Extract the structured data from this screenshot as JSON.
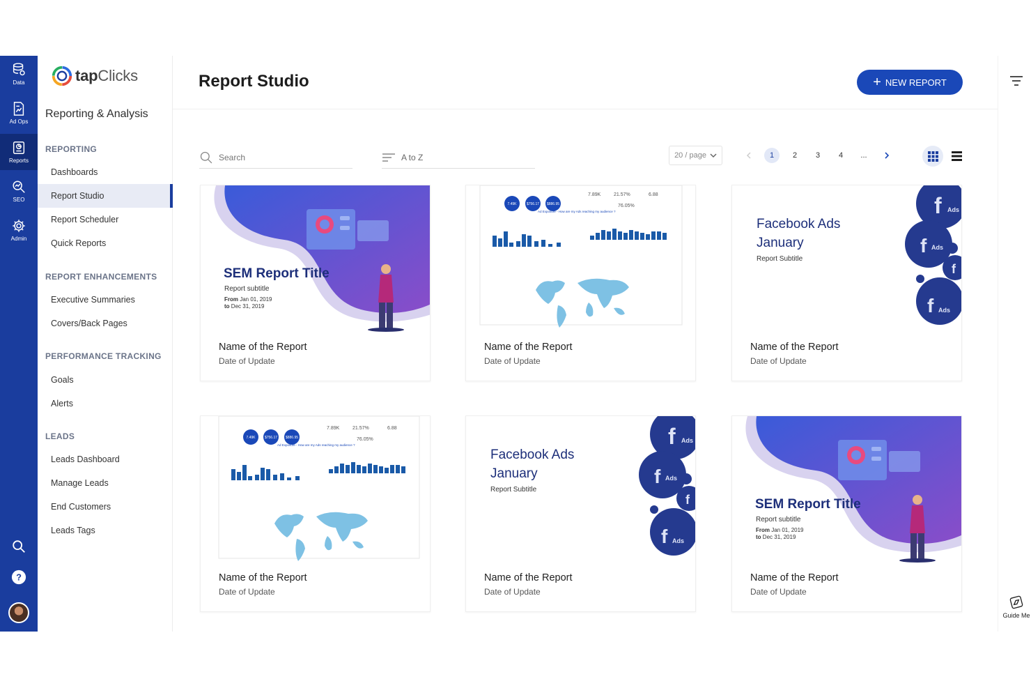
{
  "rail": {
    "items": [
      {
        "label": "Data",
        "icon": "database-icon"
      },
      {
        "label": "Ad Ops",
        "icon": "document-chart-icon"
      },
      {
        "label": "Reports",
        "icon": "report-icon"
      },
      {
        "label": "SEO",
        "icon": "seo-icon"
      },
      {
        "label": "Admin",
        "icon": "gear-icon"
      }
    ],
    "active": "Reports"
  },
  "brand": {
    "name_bold": "tap",
    "name_light": "Clicks"
  },
  "sidebar": {
    "section_title": "Reporting & Analysis",
    "groups": [
      {
        "heading": "REPORTING",
        "items": [
          "Dashboards",
          "Report Studio",
          "Report Scheduler",
          "Quick Reports"
        ]
      },
      {
        "heading": "REPORT ENHANCEMENTS",
        "items": [
          "Executive Summaries",
          "Covers/Back Pages"
        ]
      },
      {
        "heading": "PERFORMANCE TRACKING",
        "items": [
          "Goals",
          "Alerts"
        ]
      },
      {
        "heading": "LEADS",
        "items": [
          "Leads Dashboard",
          "Manage Leads",
          "End Customers",
          "Leads Tags"
        ]
      }
    ],
    "active_item": "Report Studio"
  },
  "header": {
    "title": "Report Studio",
    "new_report_label": "NEW REPORT"
  },
  "toolbar": {
    "search_placeholder": "Search",
    "sort_label": "A to Z",
    "per_page": "20 / page",
    "pages": [
      "1",
      "2",
      "3",
      "4",
      "..."
    ],
    "current_page": "1",
    "view_mode": "grid"
  },
  "thumbs": {
    "sem": {
      "title": "SEM Report Title",
      "subtitle": "Report subtitle",
      "from_label": "From",
      "from_date": "Jan 01, 2019",
      "to_label": "to",
      "to_date": "Dec 31, 2019"
    },
    "fb": {
      "title_line1": "Facebook Ads",
      "title_line2": "January",
      "subtitle": "Report Subtitle",
      "badge": "Ads"
    },
    "dash": {
      "bubbles": [
        "7.49K",
        "$756.17",
        "$886.95"
      ],
      "kpis": [
        "7.89K",
        "21.57%",
        "6.88"
      ],
      "pct": "76.05%",
      "caption": "Ad Exposure - How are my Ads reaching my audience ?"
    }
  },
  "cards": [
    {
      "name": "Name of the Report",
      "date": "Date of Update",
      "thumb": "sem"
    },
    {
      "name": "Name of the Report",
      "date": "Date of Update",
      "thumb": "dash"
    },
    {
      "name": "Name of the Report",
      "date": "Date of Update",
      "thumb": "fb"
    },
    {
      "name": "Name of the Report",
      "date": "Date of Update",
      "thumb": "dash"
    },
    {
      "name": "Name of the Report",
      "date": "Date of Update",
      "thumb": "fb"
    },
    {
      "name": "Name of the Report",
      "date": "Date of Update",
      "thumb": "sem"
    }
  ],
  "right_strip": {
    "guide_label": "Guide Me"
  },
  "colors": {
    "rail": "#1a3d9e",
    "accent": "#1a48b8",
    "active_nav_bg": "#e8ebf5",
    "thumb_title": "#1d2f7a"
  }
}
